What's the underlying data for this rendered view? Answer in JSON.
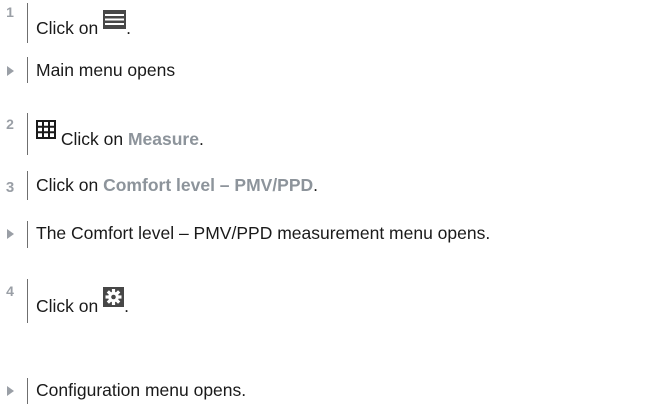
{
  "steps": [
    {
      "marker": "1",
      "before": "Click on ",
      "after": ".",
      "icon": "hamburger-menu-icon"
    },
    {
      "text": "Main menu opens"
    },
    {
      "marker": "2",
      "before": " Click on ",
      "highlight": "Measure",
      "after": ".",
      "icon": "grid-icon"
    },
    {
      "marker": "3",
      "before": "Click on ",
      "highlight": "Comfort level – PMV/PPD",
      "after": "."
    },
    {
      "text": "The Comfort level – PMV/PPD measurement menu opens."
    },
    {
      "marker": "4",
      "before": "Click on ",
      "after": ".",
      "icon": "gear-icon"
    },
    {
      "text": "Configuration menu opens."
    }
  ],
  "colors": {
    "marker": "#9a9fa6",
    "highlight": "#8d949b",
    "text": "#1a1a1a",
    "icon_bg": "#474747"
  }
}
